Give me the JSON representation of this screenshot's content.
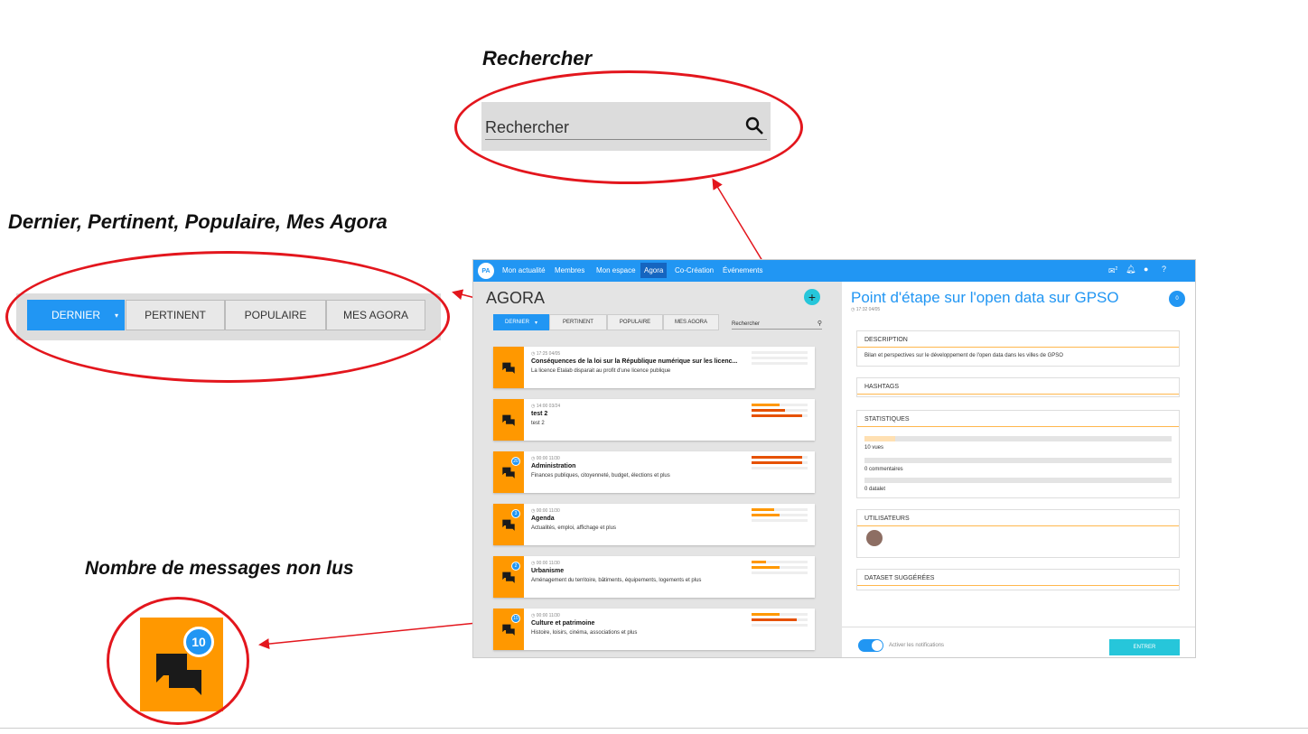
{
  "callouts": {
    "search_title": "Rechercher",
    "tabs_title": "Dernier, Pertinent, Populaire, Mes Agora",
    "unread_title": "Nombre de messages non lus"
  },
  "zoom_search": {
    "placeholder": "Rechercher",
    "icon": "search-icon"
  },
  "zoom_tabs": [
    "DERNIER",
    "PERTINENT",
    "POPULAIRE",
    "MES AGORA"
  ],
  "zoom_badge": "10",
  "colors": {
    "primary": "#2196f3",
    "orange": "#ff9800",
    "annotation": "#e3161d",
    "teal": "#26c6da"
  },
  "app": {
    "logo": "PA",
    "nav": [
      "Mon actualité",
      "Membres",
      "Mon espace",
      "Agora",
      "Co-Création",
      "Événements"
    ],
    "nav_active": "Agora",
    "topbar_icons": [
      "chat-icon",
      "bell-icon",
      "user-icon",
      "help-icon"
    ],
    "chat_count": "2",
    "left": {
      "title": "AGORA",
      "tabs": [
        "DERNIER",
        "PERTINENT",
        "POPULAIRE",
        "MES AGORA"
      ],
      "search_placeholder": "Rechercher",
      "cards": [
        {
          "time": "17:25 04/05",
          "title": "Conséquences de la loi sur la République numérique sur les licenc...",
          "desc": "La licence Etalab disparait au profit d'une licence publique",
          "badge": ""
        },
        {
          "time": "14:00 03/24",
          "title": "test 2",
          "desc": "test 2",
          "badge": ""
        },
        {
          "time": "00:00 11/30",
          "title": "Administration",
          "desc": "Finances publiques, citoyenneté, budget, élections et plus",
          "badge": "20"
        },
        {
          "time": "00:00 11/30",
          "title": "Agenda",
          "desc": "Actualités, emploi, affichage et plus",
          "badge": "3"
        },
        {
          "time": "00:00 11/30",
          "title": "Urbanisme",
          "desc": "Aménagement du territoire, bâtiments, équipements, logements et plus",
          "badge": "2"
        },
        {
          "time": "00:00 11/30",
          "title": "Culture et patrimoine",
          "desc": "Histoire, loisirs, cinéma, associations et plus",
          "badge": "10"
        }
      ]
    },
    "right": {
      "title": "Point d'étape sur l'open data sur GPSO",
      "time": "17:32 04/05",
      "badge": "0",
      "description_header": "DESCRIPTION",
      "description": "Bilan et perspectives sur le développement de l'open data dans les villes de GPSO",
      "hashtags_header": "HASHTAGS",
      "stats_header": "STATISTIQUES",
      "stats": [
        "10 vues",
        "0 commentaires",
        "0 datalet"
      ],
      "users_header": "UTILISATEURS",
      "datasets_header": "DATASET SUGGÉRÉES",
      "notifications_label": "Activer les notifications",
      "enter_label": "ENTRER"
    }
  }
}
